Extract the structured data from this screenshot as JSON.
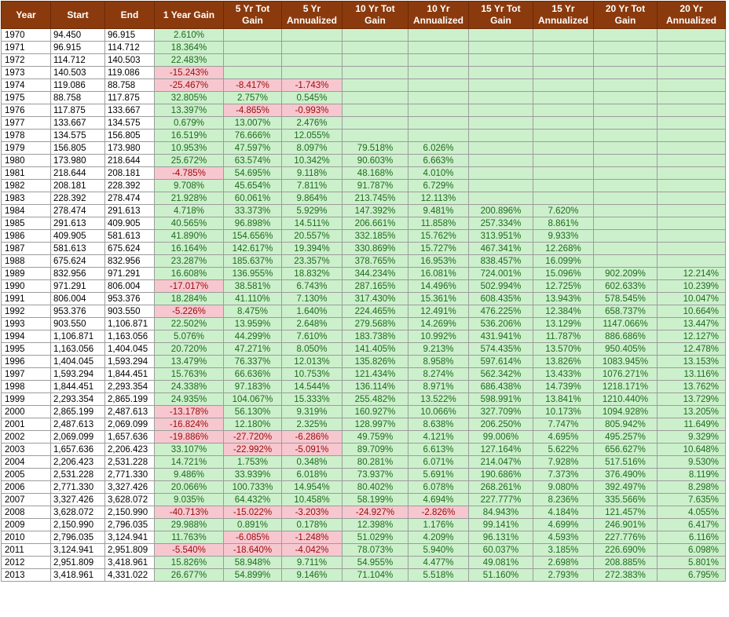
{
  "colors": {
    "header_bg": "#8b3a0d",
    "positive_bg": "#ccf0cc",
    "positive_text": "#1d6b1d",
    "negative_bg": "#f7c7cf",
    "negative_text": "#9c0a0a"
  },
  "headers": [
    "Year",
    "Start",
    "End",
    "1 Year Gain",
    "5 Yr Tot Gain",
    "5 Yr Annualized",
    "10 Yr Tot Gain",
    "10 Yr Annualized",
    "15 Yr Tot Gain",
    "15 Yr Annualized",
    "20 Yr Tot Gain",
    "20 Yr Annualized"
  ],
  "rows": [
    [
      "1970",
      "94.450",
      "96.915",
      "2.610%",
      "",
      "",
      "",
      "",
      "",
      "",
      "",
      ""
    ],
    [
      "1971",
      "96.915",
      "114.712",
      "18.364%",
      "",
      "",
      "",
      "",
      "",
      "",
      "",
      ""
    ],
    [
      "1972",
      "114.712",
      "140.503",
      "22.483%",
      "",
      "",
      "",
      "",
      "",
      "",
      "",
      ""
    ],
    [
      "1973",
      "140.503",
      "119.086",
      "-15.243%",
      "",
      "",
      "",
      "",
      "",
      "",
      "",
      ""
    ],
    [
      "1974",
      "119.086",
      "88.758",
      "-25.467%",
      "-8.417%",
      "-1.743%",
      "",
      "",
      "",
      "",
      "",
      ""
    ],
    [
      "1975",
      "88.758",
      "117.875",
      "32.805%",
      "2.757%",
      "0.545%",
      "",
      "",
      "",
      "",
      "",
      ""
    ],
    [
      "1976",
      "117.875",
      "133.667",
      "13.397%",
      "-4.865%",
      "-0.993%",
      "",
      "",
      "",
      "",
      "",
      ""
    ],
    [
      "1977",
      "133.667",
      "134.575",
      "0.679%",
      "13.007%",
      "2.476%",
      "",
      "",
      "",
      "",
      "",
      ""
    ],
    [
      "1978",
      "134.575",
      "156.805",
      "16.519%",
      "76.666%",
      "12.055%",
      "",
      "",
      "",
      "",
      "",
      ""
    ],
    [
      "1979",
      "156.805",
      "173.980",
      "10.953%",
      "47.597%",
      "8.097%",
      "79.518%",
      "6.026%",
      "",
      "",
      "",
      ""
    ],
    [
      "1980",
      "173.980",
      "218.644",
      "25.672%",
      "63.574%",
      "10.342%",
      "90.603%",
      "6.663%",
      "",
      "",
      "",
      ""
    ],
    [
      "1981",
      "218.644",
      "208.181",
      "-4.785%",
      "54.695%",
      "9.118%",
      "48.168%",
      "4.010%",
      "",
      "",
      "",
      ""
    ],
    [
      "1982",
      "208.181",
      "228.392",
      "9.708%",
      "45.654%",
      "7.811%",
      "91.787%",
      "6.729%",
      "",
      "",
      "",
      ""
    ],
    [
      "1983",
      "228.392",
      "278.474",
      "21.928%",
      "60.061%",
      "9.864%",
      "213.745%",
      "12.113%",
      "",
      "",
      "",
      ""
    ],
    [
      "1984",
      "278.474",
      "291.613",
      "4.718%",
      "33.373%",
      "5.929%",
      "147.392%",
      "9.481%",
      "200.896%",
      "7.620%",
      "",
      ""
    ],
    [
      "1985",
      "291.613",
      "409.905",
      "40.565%",
      "96.898%",
      "14.511%",
      "206.661%",
      "11.858%",
      "257.334%",
      "8.861%",
      "",
      ""
    ],
    [
      "1986",
      "409.905",
      "581.613",
      "41.890%",
      "154.656%",
      "20.557%",
      "332.185%",
      "15.762%",
      "313.951%",
      "9.933%",
      "",
      ""
    ],
    [
      "1987",
      "581.613",
      "675.624",
      "16.164%",
      "142.617%",
      "19.394%",
      "330.869%",
      "15.727%",
      "467.341%",
      "12.268%",
      "",
      ""
    ],
    [
      "1988",
      "675.624",
      "832.956",
      "23.287%",
      "185.637%",
      "23.357%",
      "378.765%",
      "16.953%",
      "838.457%",
      "16.099%",
      "",
      ""
    ],
    [
      "1989",
      "832.956",
      "971.291",
      "16.608%",
      "136.955%",
      "18.832%",
      "344.234%",
      "16.081%",
      "724.001%",
      "15.096%",
      "902.209%",
      "12.214%"
    ],
    [
      "1990",
      "971.291",
      "806.004",
      "-17.017%",
      "38.581%",
      "6.743%",
      "287.165%",
      "14.496%",
      "502.994%",
      "12.725%",
      "602.633%",
      "10.239%"
    ],
    [
      "1991",
      "806.004",
      "953.376",
      "18.284%",
      "41.110%",
      "7.130%",
      "317.430%",
      "15.361%",
      "608.435%",
      "13.943%",
      "578.545%",
      "10.047%"
    ],
    [
      "1992",
      "953.376",
      "903.550",
      "-5.226%",
      "8.475%",
      "1.640%",
      "224.465%",
      "12.491%",
      "476.225%",
      "12.384%",
      "658.737%",
      "10.664%"
    ],
    [
      "1993",
      "903.550",
      "1,106.871",
      "22.502%",
      "13.959%",
      "2.648%",
      "279.568%",
      "14.269%",
      "536.206%",
      "13.129%",
      "1147.066%",
      "13.447%"
    ],
    [
      "1994",
      "1,106.871",
      "1,163.056",
      "5.076%",
      "44.299%",
      "7.610%",
      "183.738%",
      "10.992%",
      "431.941%",
      "11.787%",
      "886.686%",
      "12.127%"
    ],
    [
      "1995",
      "1,163.056",
      "1,404.045",
      "20.720%",
      "47.271%",
      "8.050%",
      "141.405%",
      "9.213%",
      "574.435%",
      "13.570%",
      "950.405%",
      "12.478%"
    ],
    [
      "1996",
      "1,404.045",
      "1,593.294",
      "13.479%",
      "76.337%",
      "12.013%",
      "135.826%",
      "8.958%",
      "597.614%",
      "13.826%",
      "1083.945%",
      "13.153%"
    ],
    [
      "1997",
      "1,593.294",
      "1,844.451",
      "15.763%",
      "66.636%",
      "10.753%",
      "121.434%",
      "8.274%",
      "562.342%",
      "13.433%",
      "1076.271%",
      "13.116%"
    ],
    [
      "1998",
      "1,844.451",
      "2,293.354",
      "24.338%",
      "97.183%",
      "14.544%",
      "136.114%",
      "8.971%",
      "686.438%",
      "14.739%",
      "1218.171%",
      "13.762%"
    ],
    [
      "1999",
      "2,293.354",
      "2,865.199",
      "24.935%",
      "104.067%",
      "15.333%",
      "255.482%",
      "13.522%",
      "598.991%",
      "13.841%",
      "1210.440%",
      "13.729%"
    ],
    [
      "2000",
      "2,865.199",
      "2,487.613",
      "-13.178%",
      "56.130%",
      "9.319%",
      "160.927%",
      "10.066%",
      "327.709%",
      "10.173%",
      "1094.928%",
      "13.205%"
    ],
    [
      "2001",
      "2,487.613",
      "2,069.099",
      "-16.824%",
      "12.180%",
      "2.325%",
      "128.997%",
      "8.638%",
      "206.250%",
      "7.747%",
      "805.942%",
      "11.649%"
    ],
    [
      "2002",
      "2,069.099",
      "1,657.636",
      "-19.886%",
      "-27.720%",
      "-6.286%",
      "49.759%",
      "4.121%",
      "99.006%",
      "4.695%",
      "495.257%",
      "9.329%"
    ],
    [
      "2003",
      "1,657.636",
      "2,206.423",
      "33.107%",
      "-22.992%",
      "-5.091%",
      "89.709%",
      "6.613%",
      "127.164%",
      "5.622%",
      "656.627%",
      "10.648%"
    ],
    [
      "2004",
      "2,206.423",
      "2,531.228",
      "14.721%",
      "1.753%",
      "0.348%",
      "80.281%",
      "6.071%",
      "214.047%",
      "7.928%",
      "517.516%",
      "9.530%"
    ],
    [
      "2005",
      "2,531.228",
      "2,771.330",
      "9.486%",
      "33.939%",
      "6.018%",
      "73.937%",
      "5.691%",
      "190.686%",
      "7.373%",
      "376.490%",
      "8.119%"
    ],
    [
      "2006",
      "2,771.330",
      "3,327.426",
      "20.066%",
      "100.733%",
      "14.954%",
      "80.402%",
      "6.078%",
      "268.261%",
      "9.080%",
      "392.497%",
      "8.298%"
    ],
    [
      "2007",
      "3,327.426",
      "3,628.072",
      "9.035%",
      "64.432%",
      "10.458%",
      "58.199%",
      "4.694%",
      "227.777%",
      "8.236%",
      "335.566%",
      "7.635%"
    ],
    [
      "2008",
      "3,628.072",
      "2,150.990",
      "-40.713%",
      "-15.022%",
      "-3.203%",
      "-24.927%",
      "-2.826%",
      "84.943%",
      "4.184%",
      "121.457%",
      "4.055%"
    ],
    [
      "2009",
      "2,150.990",
      "2,796.035",
      "29.988%",
      "0.891%",
      "0.178%",
      "12.398%",
      "1.176%",
      "99.141%",
      "4.699%",
      "246.901%",
      "6.417%"
    ],
    [
      "2010",
      "2,796.035",
      "3,124.941",
      "11.763%",
      "-6.085%",
      "-1.248%",
      "51.029%",
      "4.209%",
      "96.131%",
      "4.593%",
      "227.776%",
      "6.116%"
    ],
    [
      "2011",
      "3,124.941",
      "2,951.809",
      "-5.540%",
      "-18.640%",
      "-4.042%",
      "78.073%",
      "5.940%",
      "60.037%",
      "3.185%",
      "226.690%",
      "6.098%"
    ],
    [
      "2012",
      "2,951.809",
      "3,418.961",
      "15.826%",
      "58.948%",
      "9.711%",
      "54.955%",
      "4.477%",
      "49.081%",
      "2.698%",
      "208.885%",
      "5.801%"
    ],
    [
      "2013",
      "3,418.961",
      "4,331.022",
      "26.677%",
      "54.899%",
      "9.146%",
      "71.104%",
      "5.518%",
      "51.160%",
      "2.793%",
      "272.383%",
      "6.795%"
    ]
  ]
}
